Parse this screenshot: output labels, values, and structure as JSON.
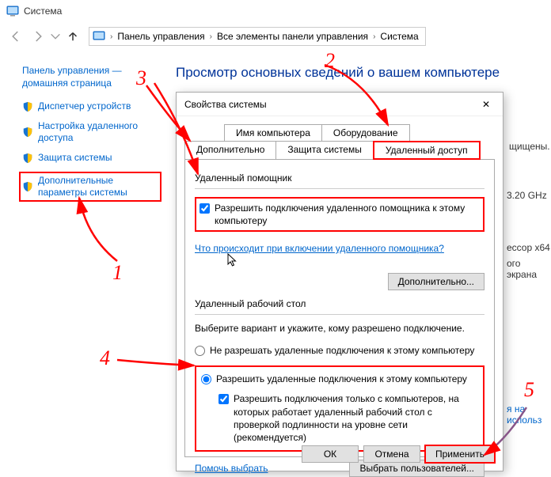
{
  "window": {
    "title": "Система"
  },
  "breadcrumbs": {
    "p0": "Панель управления",
    "p1": "Все элементы панели управления",
    "p2": "Система"
  },
  "sidebar": {
    "home": "Панель управления — домашняя страница",
    "link0": "Диспетчер устройств",
    "link1": "Настройка удаленного доступа",
    "link2": "Защита системы",
    "link3": "Дополнительные параметры системы"
  },
  "content": {
    "heading": "Просмотр основных сведений о вашем компьютере"
  },
  "dialog": {
    "title": "Свойства системы",
    "tabs": {
      "name": "Имя компьютера",
      "hardware": "Оборудование",
      "advanced": "Дополнительно",
      "protection": "Защита системы",
      "remote": "Удаленный доступ"
    },
    "assist": {
      "header": "Удаленный помощник",
      "checkbox": "Разрешить подключения удаленного помощника к этому компьютеру",
      "link": "Что происходит при включении удаленного помощника?",
      "btn": "Дополнительно..."
    },
    "rdp": {
      "header": "Удаленный рабочий стол",
      "instr": "Выберите вариант и укажите, кому разрешено подключение.",
      "opt_deny": "Не разрешать удаленные подключения к этому компьютеру",
      "opt_allow": "Разрешить удаленные подключения к этому компьютеру",
      "nla": "Разрешить подключения только с компьютеров, на которых работает удаленный рабочий стол с проверкой подлинности на уровне сети (рекомендуется)",
      "help_link": "Помочь выбрать",
      "users_btn": "Выбрать пользователей..."
    },
    "buttons": {
      "ok": "ОК",
      "cancel": "Отмена",
      "apply": "Применить"
    }
  },
  "bg": {
    "t1": "щищены.",
    "t2": "3.20 GHz",
    "t3": "ессор x64",
    "t4": "ого экрана",
    "t5": "я на использ"
  },
  "annot": {
    "n1": "1",
    "n2": "2",
    "n3": "3",
    "n4": "4",
    "n5": "5"
  }
}
